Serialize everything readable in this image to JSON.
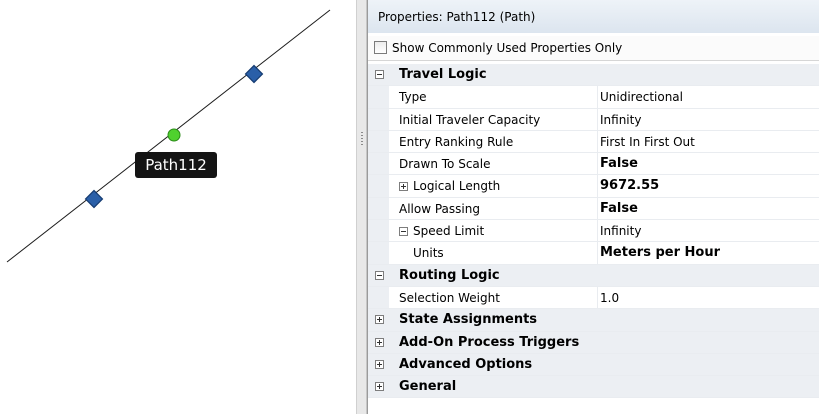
{
  "canvas": {
    "object_label": "Path112"
  },
  "panel": {
    "title": "Properties: Path112 (Path)",
    "show_common_label": "Show Commonly Used Properties Only",
    "show_common_checked": false
  },
  "categories": {
    "travel_logic": "Travel Logic",
    "routing_logic": "Routing Logic",
    "state_assignments": "State Assignments",
    "addon_triggers": "Add-On Process Triggers",
    "advanced_options": "Advanced Options",
    "general": "General"
  },
  "properties": {
    "type": {
      "name": "Type",
      "value": "Unidirectional"
    },
    "capacity": {
      "name": "Initial Traveler Capacity",
      "value": "Infinity"
    },
    "ranking": {
      "name": "Entry Ranking Rule",
      "value": "First In First Out"
    },
    "drawn_to_scale": {
      "name": "Drawn To Scale",
      "value": "False"
    },
    "logical_length": {
      "name": "Logical Length",
      "value": "9672.55"
    },
    "allow_passing": {
      "name": "Allow Passing",
      "value": "False"
    },
    "speed_limit": {
      "name": "Speed Limit",
      "value": "Infinity"
    },
    "units": {
      "name": "Units",
      "value": "Meters per Hour"
    },
    "selection_weight": {
      "name": "Selection Weight",
      "value": "1.0"
    }
  },
  "icons": {
    "node_left": "diamond-node-icon",
    "node_right": "diamond-node-icon",
    "path_midpoint": "green-circle-icon",
    "expand": "plus-box-icon",
    "collapse": "minus-box-icon"
  },
  "colors": {
    "node_fill": "#2a5fa8",
    "midpoint_fill": "#4fd12e",
    "label_bg": "#141414",
    "category_bg": "#eceff3",
    "title_bg": "#dce5ef"
  }
}
